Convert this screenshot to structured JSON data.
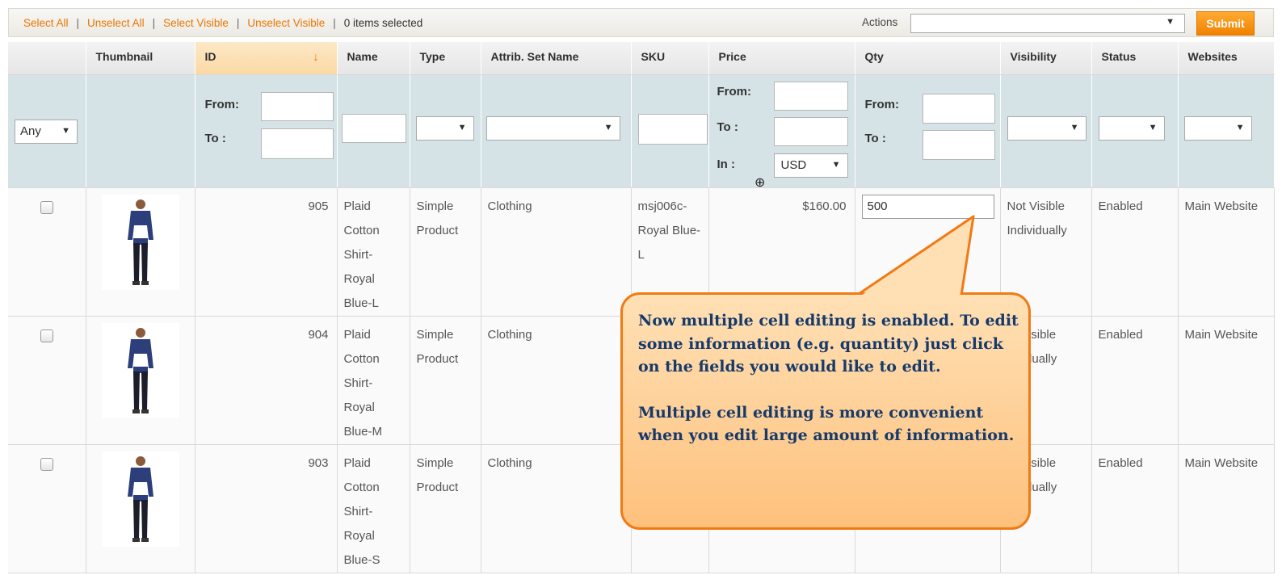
{
  "massaction": {
    "select_all": "Select All",
    "unselect_all": "Unselect All",
    "select_visible": "Select Visible",
    "unselect_visible": "Unselect Visible",
    "separator": "|",
    "items_selected": "0 items selected",
    "actions_label": "Actions",
    "actions_value": "",
    "submit_label": "Submit"
  },
  "columns": {
    "thumbnail": "Thumbnail",
    "id": "ID",
    "name": "Name",
    "type": "Type",
    "attrib_set": "Attrib. Set Name",
    "sku": "SKU",
    "price": "Price",
    "qty": "Qty",
    "visibility": "Visibility",
    "status": "Status",
    "websites": "Websites"
  },
  "filters": {
    "massaction_any": "Any",
    "from_label": "From:",
    "to_label": "To :",
    "in_label": "In :",
    "currency": "USD"
  },
  "rows": [
    {
      "id": "905",
      "name": "Plaid Cotton Shirt- Royal Blue-L",
      "type": "Simple Product",
      "attrib_set": "Clothing",
      "sku": "msj006c- Royal Blue-L",
      "price": "$160.00",
      "qty": "500",
      "visibility": "Not Visible Individually",
      "status": "Enabled",
      "websites": "Main Website"
    },
    {
      "id": "904",
      "name": "Plaid Cotton Shirt- Royal Blue-M",
      "type": "Simple Product",
      "attrib_set": "Clothing",
      "sku": "",
      "price": "",
      "qty": "",
      "visibility": "ot Visible dividually",
      "status": "Enabled",
      "websites": "Main Website"
    },
    {
      "id": "903",
      "name": "Plaid Cotton Shirt- Royal Blue-S",
      "type": "Simple Product",
      "attrib_set": "Clothing",
      "sku": "",
      "price": "",
      "qty": "",
      "visibility": "ot Visible dividually",
      "status": "Enabled",
      "websites": "Main Website"
    }
  ],
  "callout": {
    "paragraph1": "Now multiple cell editing is enabled. To edit some information (e.g. quantity) just click on the fields you would like to edit.",
    "paragraph2": "Multiple cell editing is more convenient when you edit large amount of information."
  },
  "colors": {
    "accent": "#ea7601",
    "filter_bg": "#d5e3e6",
    "callout_border": "#f07a14",
    "callout_text": "#153a6b"
  }
}
